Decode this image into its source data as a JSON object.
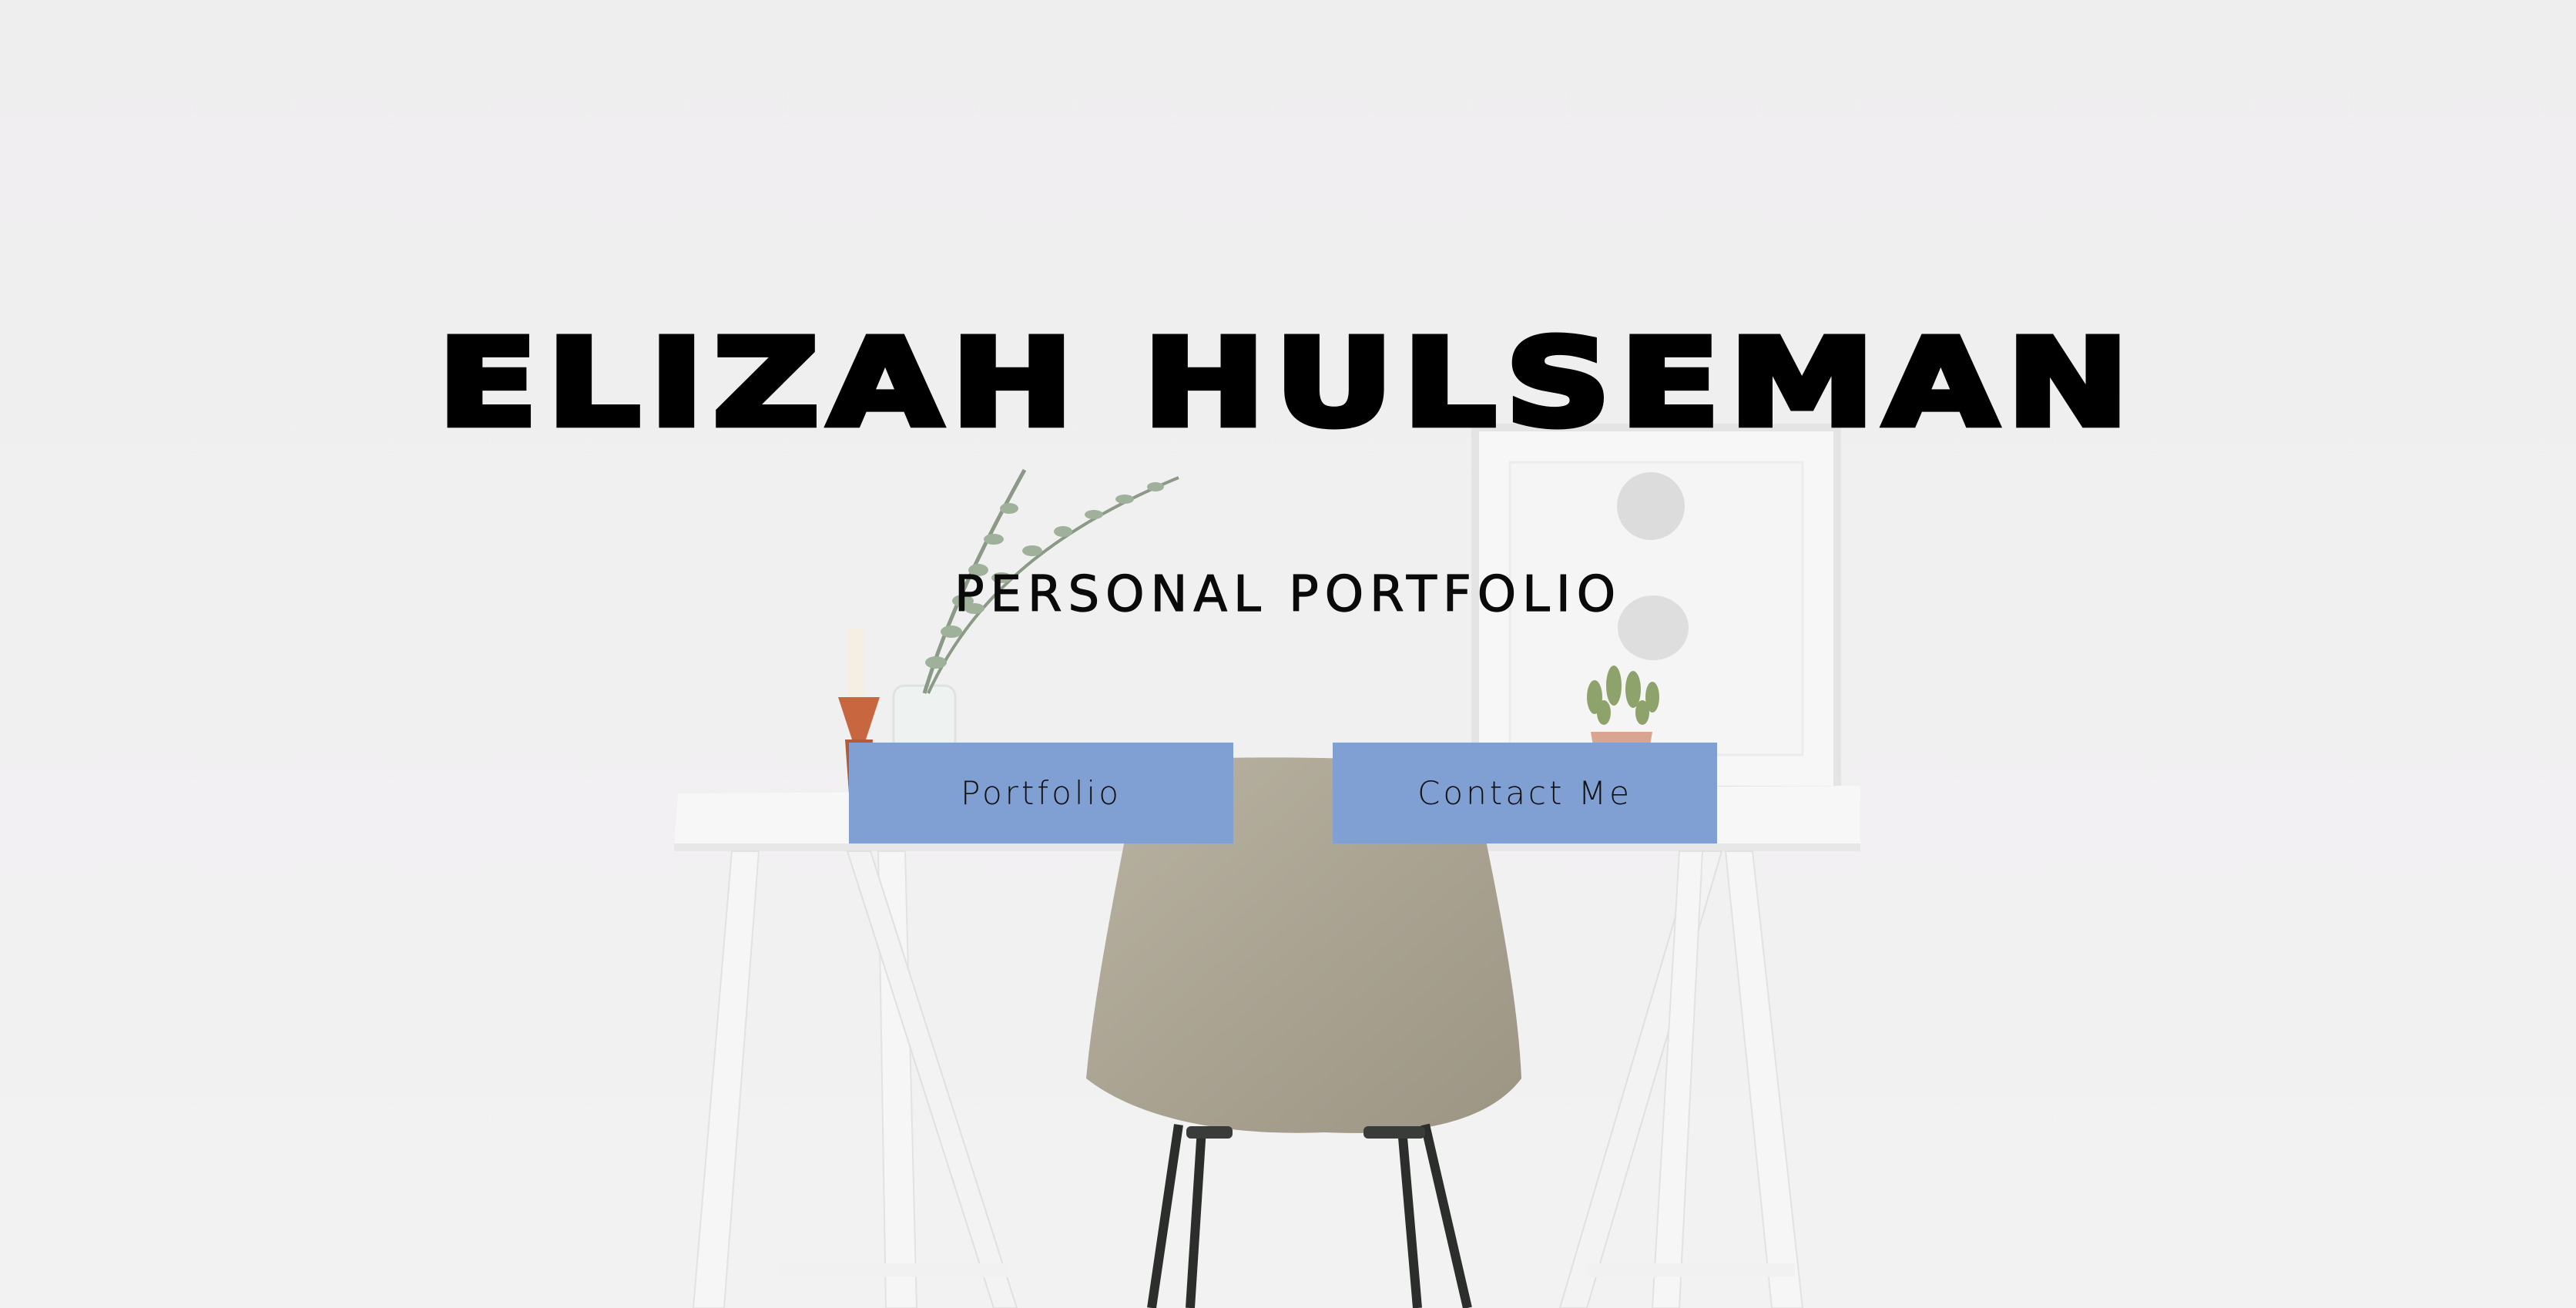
{
  "hero": {
    "title": "ELIZAH HULSEMAN",
    "subtitle": "PERSONAL PORTFOLIO"
  },
  "buttons": {
    "portfolio_label": "Portfolio",
    "contact_label": "Contact Me"
  },
  "colors": {
    "button_background": "#809fd2",
    "text": "#000000",
    "background": "#f1f0f1"
  },
  "background_image": {
    "subject": "white desk with beige chair, eucalyptus vase, candle, framed art and small plant"
  }
}
